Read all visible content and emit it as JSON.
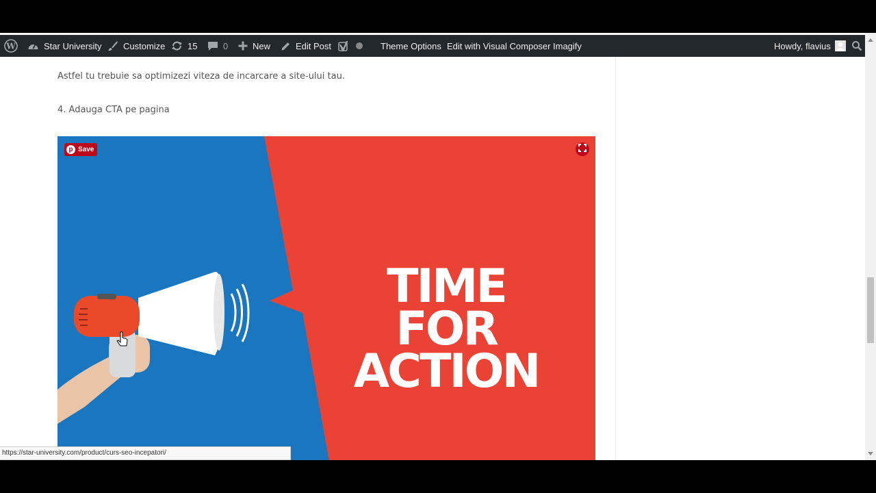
{
  "admin_bar": {
    "site_name": "Star University",
    "customize": "Customize",
    "updates_count": "15",
    "comments_count": "0",
    "new_label": "New",
    "edit_post": "Edit Post",
    "theme_options": "Theme Options",
    "edit_visual_composer": "Edit with Visual Composer",
    "imagify": "Imagify",
    "howdy": "Howdy, flavius"
  },
  "content": {
    "paragraph_1": "Astfel tu trebuie sa optimizezi viteza de incarcare a site-ului tau.",
    "paragraph_2": "4. Adauga CTA pe pagina"
  },
  "image": {
    "headline_line1": "TIME",
    "headline_line2": "FOR",
    "headline_line3": "ACTION",
    "pin_save_label": "Save",
    "pin_letter": "p"
  },
  "status_bar": {
    "url": "https://star-university.com/product/curs-seo-incepatori/"
  },
  "colors": {
    "admin_bar_bg": "#23282d",
    "image_blue": "#1a76be",
    "image_red": "#ea4335",
    "pinterest_red": "#bd081c"
  },
  "icons": [
    "wordpress-icon",
    "dashboard-icon",
    "brush-icon",
    "updates-icon",
    "comment-icon",
    "plus-icon",
    "pencil-icon",
    "yoast-icon",
    "status-dot-icon",
    "avatar",
    "search-icon",
    "megaphone-illustration",
    "fullscreen-icon",
    "pointer-cursor-icon"
  ]
}
